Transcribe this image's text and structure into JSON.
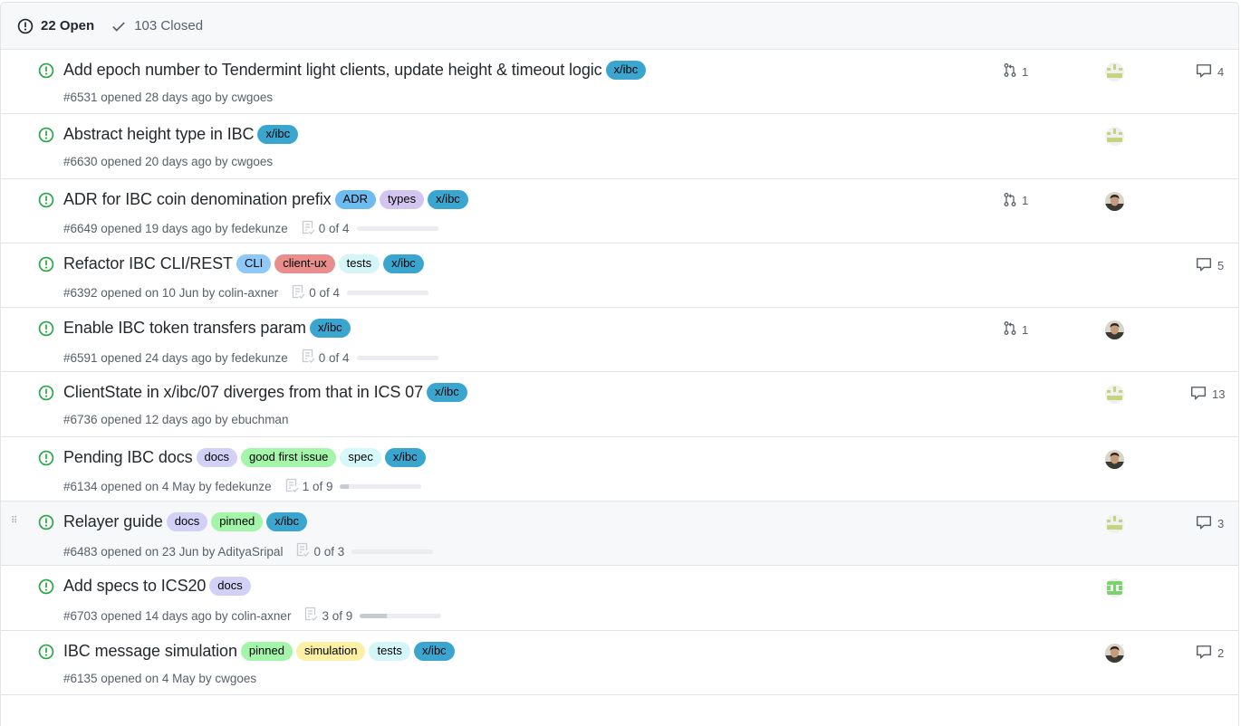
{
  "header": {
    "open_label": "22 Open",
    "closed_label": "103 Closed"
  },
  "colors": {
    "open_icon": "#28a745",
    "text": "#24292e",
    "muted": "#586069"
  },
  "issues": [
    {
      "title": "Add epoch number to Tendermint light clients, update height & timeout logic",
      "labels": [
        {
          "name": "x/ibc",
          "color": "#3aa6d0"
        }
      ],
      "meta": "#6531 opened 28 days ago by cwgoes",
      "tasks": null,
      "linked_prs": "1",
      "avatar": "identicon-lime",
      "comments": "4"
    },
    {
      "title": "Abstract height type in IBC",
      "labels": [
        {
          "name": "x/ibc",
          "color": "#3aa6d0"
        }
      ],
      "meta": "#6630 opened 20 days ago by cwgoes",
      "tasks": null,
      "linked_prs": null,
      "avatar": "identicon-lime",
      "comments": null
    },
    {
      "title": "ADR for IBC coin denomination prefix",
      "labels": [
        {
          "name": "ADR",
          "color": "#6cbcf0"
        },
        {
          "name": "types",
          "color": "#d4c5f0"
        },
        {
          "name": "x/ibc",
          "color": "#3aa6d0"
        }
      ],
      "meta": "#6649 opened 19 days ago by fedekunze",
      "tasks": {
        "label": "0 of 4",
        "fraction": 0
      },
      "linked_prs": "1",
      "avatar": "photo",
      "comments": null
    },
    {
      "title": "Refactor IBC CLI/REST",
      "labels": [
        {
          "name": "CLI",
          "color": "#8ec8f8"
        },
        {
          "name": "client-ux",
          "color": "#ea8d8d"
        },
        {
          "name": "tests",
          "color": "#d5f6f9"
        },
        {
          "name": "x/ibc",
          "color": "#3aa6d0"
        }
      ],
      "meta": "#6392 opened on 10 Jun by colin-axner",
      "tasks": {
        "label": "0 of 4",
        "fraction": 0
      },
      "linked_prs": null,
      "avatar": null,
      "comments": "5"
    },
    {
      "title": "Enable IBC token transfers param",
      "labels": [
        {
          "name": "x/ibc",
          "color": "#3aa6d0"
        }
      ],
      "meta": "#6591 opened 24 days ago by fedekunze",
      "tasks": {
        "label": "0 of 4",
        "fraction": 0
      },
      "linked_prs": "1",
      "avatar": "photo",
      "comments": null
    },
    {
      "title": "ClientState in x/ibc/07 diverges from that in ICS 07",
      "labels": [
        {
          "name": "x/ibc",
          "color": "#3aa6d0"
        }
      ],
      "meta": "#6736 opened 12 days ago by ebuchman",
      "tasks": null,
      "linked_prs": null,
      "avatar": "identicon-lime",
      "comments": "13"
    },
    {
      "title": "Pending IBC docs",
      "labels": [
        {
          "name": "docs",
          "color": "#d2d0f6"
        },
        {
          "name": "good first issue",
          "color": "#a2f5a9"
        },
        {
          "name": "spec",
          "color": "#d7f8fa"
        },
        {
          "name": "x/ibc",
          "color": "#3aa6d0"
        }
      ],
      "meta": "#6134 opened on 4 May by fedekunze",
      "tasks": {
        "label": "1 of 9",
        "fraction": 0.111
      },
      "linked_prs": null,
      "avatar": "photo",
      "comments": null
    },
    {
      "title": "Relayer guide",
      "labels": [
        {
          "name": "docs",
          "color": "#d2d0f6"
        },
        {
          "name": "pinned",
          "color": "#a2f5a9"
        },
        {
          "name": "x/ibc",
          "color": "#3aa6d0"
        }
      ],
      "meta": "#6483 opened on 23 Jun by AdityaSripal",
      "tasks": {
        "label": "0 of 3",
        "fraction": 0
      },
      "linked_prs": null,
      "avatar": "identicon-lime",
      "comments": "3",
      "hover": true
    },
    {
      "title": "Add specs to ICS20",
      "labels": [
        {
          "name": "docs",
          "color": "#d2d0f6"
        }
      ],
      "meta": "#6703 opened 14 days ago by colin-axner",
      "tasks": {
        "label": "3 of 9",
        "fraction": 0.333
      },
      "linked_prs": null,
      "avatar": "identicon-green",
      "comments": null
    },
    {
      "title": "IBC message simulation",
      "labels": [
        {
          "name": "pinned",
          "color": "#a2f5a9"
        },
        {
          "name": "simulation",
          "color": "#fbf0a5"
        },
        {
          "name": "tests",
          "color": "#d5f6f9"
        },
        {
          "name": "x/ibc",
          "color": "#3aa6d0"
        }
      ],
      "meta": "#6135 opened on 4 May by cwgoes",
      "tasks": null,
      "linked_prs": null,
      "avatar": "photo",
      "comments": "2"
    }
  ]
}
